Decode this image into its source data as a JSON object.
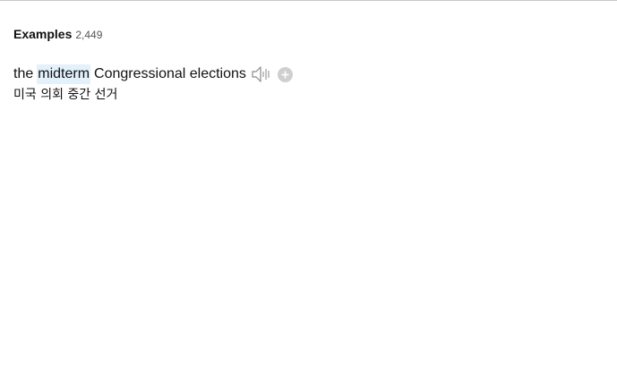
{
  "section": {
    "title": "Examples",
    "count": "2,449"
  },
  "example": {
    "before": "the",
    "highlight": "midterm",
    "after": "Congressional elections",
    "translation": "미국 의회 중간 선거",
    "audio_icon": "speaker-icon",
    "add_icon": "plus-circle-icon"
  },
  "colors": {
    "highlight_bg": "#e3f1fb",
    "add_button_bg": "#cfcfcf"
  }
}
